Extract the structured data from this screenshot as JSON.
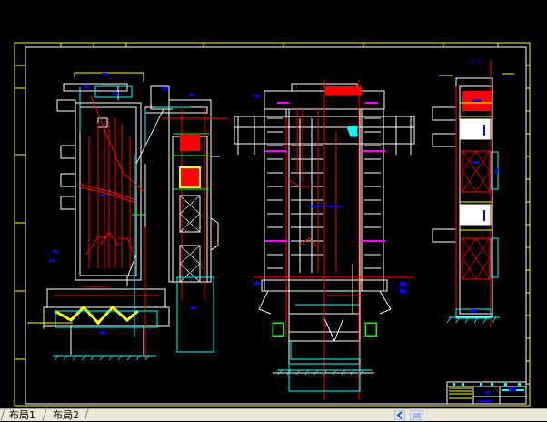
{
  "layout_tabs": [
    {
      "label": "布局1",
      "active": true
    },
    {
      "label": "布局2",
      "active": false
    }
  ],
  "drawing": {
    "section_label": "C-C",
    "colors": {
      "background": "#000000",
      "frame_outer": "#ffff00",
      "frame_inner": "#ffffff",
      "pipes": "#ff0000",
      "structure": "#ffffff",
      "ducts": "#00ffff",
      "dimensions": "#0000ff",
      "markers": "#ff00ff",
      "highlights": "#00ff00"
    }
  },
  "scrollbar": {
    "left_arrow_icon": "chevron-left-icon",
    "thumb_icon": "grip-icon"
  }
}
